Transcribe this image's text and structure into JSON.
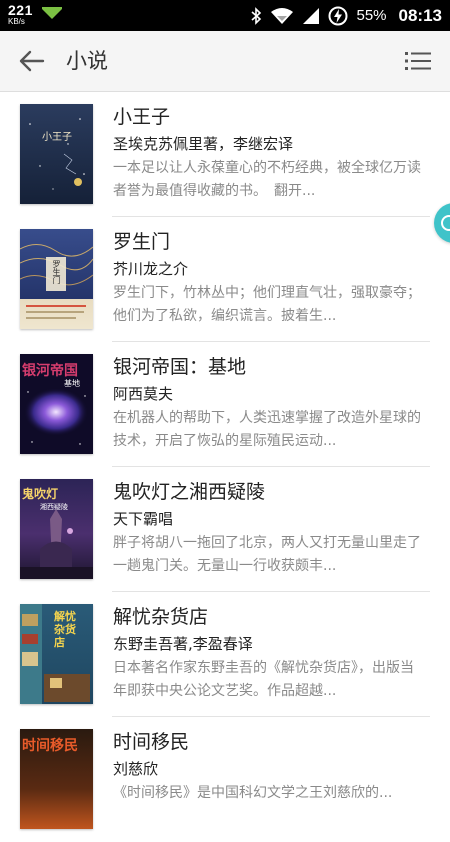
{
  "status_bar": {
    "net_speed": "221",
    "net_unit": "KB/s",
    "battery": "55%",
    "time": "08:13"
  },
  "app_bar": {
    "title": "小说",
    "back_icon": "arrow-left-icon",
    "menu_icon": "list-menu-icon"
  },
  "books": [
    {
      "title": "小王子",
      "author": "圣埃克苏佩里著，李继宏译",
      "description": "一本足以让人永葆童心的不朽经典，被全球亿万读者誉为最值得收藏的书。　翻开...",
      "cover_text": "小王子",
      "cover_color": "#1c2a45"
    },
    {
      "title": "罗生门",
      "author": "芥川龙之介",
      "description": "罗生门下，竹林丛中；他们理直气壮，强取豪夺；他们为了私欲，编织谎言。披着生...",
      "cover_text": "罗生门",
      "cover_color": "#2d3f7a"
    },
    {
      "title": "银河帝国：基地",
      "author": "阿西莫夫",
      "description": "在机器人的帮助下，人类迅速掌握了改造外星球的技术，开启了恢弘的星际殖民运动...",
      "cover_text": "银河帝国",
      "cover_subtext": "基地",
      "cover_color": "#120d2e"
    },
    {
      "title": "鬼吹灯之湘西疑陵",
      "author": "天下霸唱",
      "description": "胖子将胡八一拖回了北京，两人又打无量山里走了一趟鬼门关。无量山一行收获颇丰...",
      "cover_text": "鬼吹灯",
      "cover_subtext": "湘西疑陵",
      "cover_color": "#2a2050"
    },
    {
      "title": "解忧杂货店",
      "author": "东野圭吾著,李盈春译",
      "description": "日本著名作家东野圭吾的《解忧杂货店》，出版当年即获中央公论文艺奖。作品超越...",
      "cover_text": "解忧杂货店",
      "cover_color": "#27506e"
    },
    {
      "title": "时间移民",
      "author": "刘慈欣",
      "description": "《时间移民》是中国科幻文学之王刘慈欣的...",
      "cover_text": "时间移民",
      "cover_color": "#1a1410"
    }
  ]
}
